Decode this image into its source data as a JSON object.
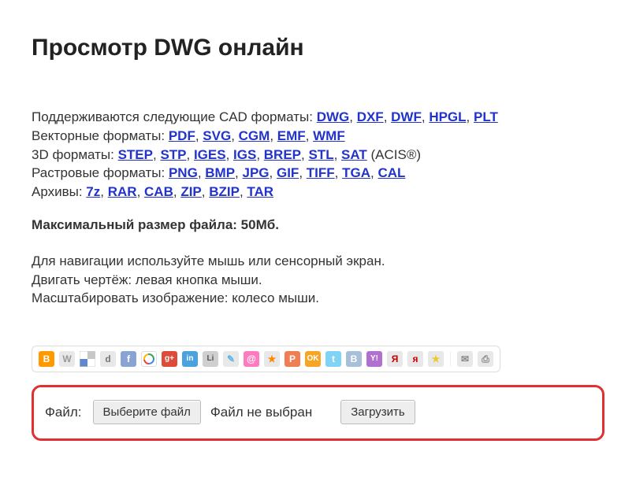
{
  "title": "Просмотр DWG онлайн",
  "formatGroups": [
    {
      "label": "Поддерживаются следующие CAD форматы: ",
      "items": [
        "DWG",
        "DXF",
        "DWF",
        "HPGL",
        "PLT"
      ]
    },
    {
      "label": "Векторные форматы: ",
      "items": [
        "PDF",
        "SVG",
        "CGM",
        "EMF",
        "WMF"
      ]
    },
    {
      "label": "3D форматы: ",
      "items": [
        "STEP",
        "STP",
        "IGES",
        "IGS",
        "BREP",
        "STL",
        "SAT"
      ],
      "tail": " (ACIS®)"
    },
    {
      "label": "Растровые форматы: ",
      "items": [
        "PNG",
        "BMP",
        "JPG",
        "GIF",
        "TIFF",
        "TGA",
        "CAL"
      ]
    },
    {
      "label": "Архивы: ",
      "items": [
        "7z",
        "RAR",
        "CAB",
        "ZIP",
        "BZIP",
        "TAR"
      ]
    }
  ],
  "maxSize": "Максимальный размер файла: 50Мб.",
  "hints": [
    "Для навигации используйте мышь или сенсорный экран.",
    "Двигать чертёж: левая кнопка мыши.",
    "Масштабировать изображение: колесо мыши."
  ],
  "share": {
    "icons": [
      {
        "name": "blogger-icon",
        "bg": "#ff9900",
        "fg": "#fff",
        "letter": "B"
      },
      {
        "name": "wordpress-icon",
        "bg": "#e8e8e8",
        "fg": "#999",
        "letter": "W"
      },
      {
        "name": "delicious-icon",
        "bg": "",
        "fg": "",
        "letter": ""
      },
      {
        "name": "digg-icon",
        "bg": "#e8e8e8",
        "fg": "#777",
        "letter": "d"
      },
      {
        "name": "facebook-icon",
        "bg": "#89a4d4",
        "fg": "#fff",
        "letter": "f"
      },
      {
        "name": "google-icon",
        "bg": "",
        "fg": "",
        "letter": ""
      },
      {
        "name": "googleplus-icon",
        "bg": "#dd4b39",
        "fg": "#fff",
        "letter": "g+"
      },
      {
        "name": "linkedin-icon",
        "bg": "#4aa3df",
        "fg": "#fff",
        "letter": "in"
      },
      {
        "name": "livejournal-icon",
        "bg": "#cfcfcf",
        "fg": "#555",
        "letter": "Li"
      },
      {
        "name": "liveinternet-icon",
        "bg": "#e8e8e8",
        "fg": "#59b4e8",
        "letter": "✎"
      },
      {
        "name": "mail-icon",
        "bg": "#ff7bbf",
        "fg": "#fff",
        "letter": "@"
      },
      {
        "name": "myspace-icon",
        "bg": "#e8e8e8",
        "fg": "#ff8800",
        "letter": "★"
      },
      {
        "name": "pinterest-icon",
        "bg": "#f07e55",
        "fg": "#fff",
        "letter": "P"
      },
      {
        "name": "odnoklassniki-icon",
        "bg": "#f6a623",
        "fg": "#fff",
        "letter": "OK"
      },
      {
        "name": "twitter-icon",
        "bg": "#7fd3f5",
        "fg": "#fff",
        "letter": "t"
      },
      {
        "name": "vk-icon",
        "bg": "#a8bfd9",
        "fg": "#fff",
        "letter": "B"
      },
      {
        "name": "yahoo-icon",
        "bg": "#b16fd0",
        "fg": "#fff",
        "letter": "Y!"
      },
      {
        "name": "yandex-icon",
        "bg": "#e8e8e8",
        "fg": "#cc0000",
        "letter": "Я"
      },
      {
        "name": "yaru-icon",
        "bg": "#e8e8e8",
        "fg": "#cc0000",
        "letter": "я"
      },
      {
        "name": "bookmark-icon",
        "bg": "#e8e8e8",
        "fg": "#eacb2d",
        "letter": "★"
      }
    ],
    "tail": [
      {
        "name": "email-icon",
        "bg": "#e8e8e8",
        "fg": "#888",
        "letter": "✉"
      },
      {
        "name": "print-icon",
        "bg": "#e8e8e8",
        "fg": "#888",
        "letter": "⎙"
      }
    ]
  },
  "upload": {
    "label": "Файл:",
    "chooseBtn": "Выберите файл",
    "noFile": "Файл не выбран",
    "uploadBtn": "Загрузить"
  }
}
